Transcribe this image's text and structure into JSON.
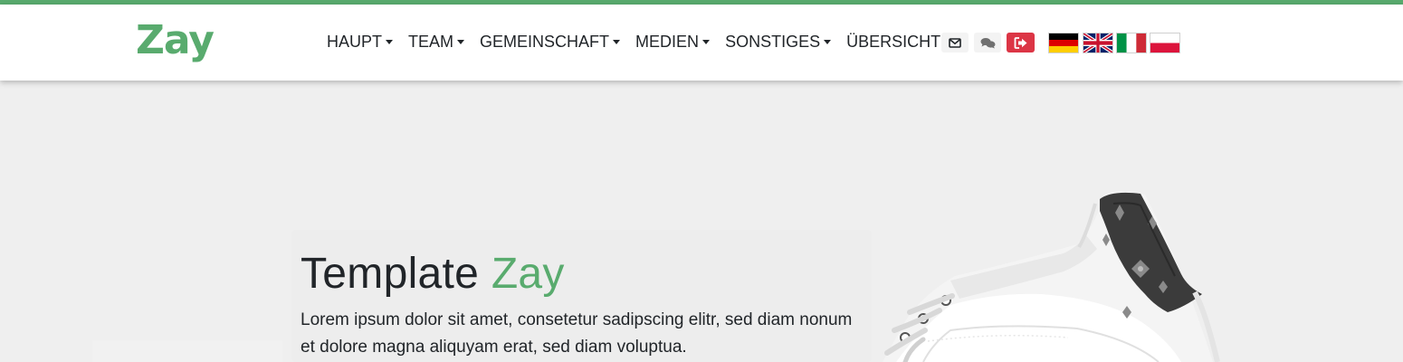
{
  "brand": {
    "logo_text": "Zay",
    "accent_color": "#59ab6e"
  },
  "nav": {
    "items": [
      {
        "label": "HAUPT"
      },
      {
        "label": "TEAM"
      },
      {
        "label": "GEMEINSCHAFT"
      },
      {
        "label": "MEDIEN"
      },
      {
        "label": "SONSTIGES"
      },
      {
        "label": "ÜBERSICHT"
      }
    ]
  },
  "header_icons": [
    {
      "icon": "envelope-icon"
    },
    {
      "icon": "chat-bubbles-icon"
    },
    {
      "icon": "sign-out-icon",
      "color": "#dc3545"
    }
  ],
  "languages": [
    {
      "icon": "german-flag-icon"
    },
    {
      "icon": "uk-flag-icon"
    },
    {
      "icon": "italian-flag-icon"
    },
    {
      "icon": "polish-flag-icon"
    }
  ],
  "hero": {
    "title_part1": "Template",
    "title_part2": "Zay",
    "text_line1": "Lorem ipsum dolor sit amet, consetetur sadipscing elitr, sed diam nonum",
    "text_line2": "et dolore magna aliquyam erat, sed diam voluptua."
  }
}
